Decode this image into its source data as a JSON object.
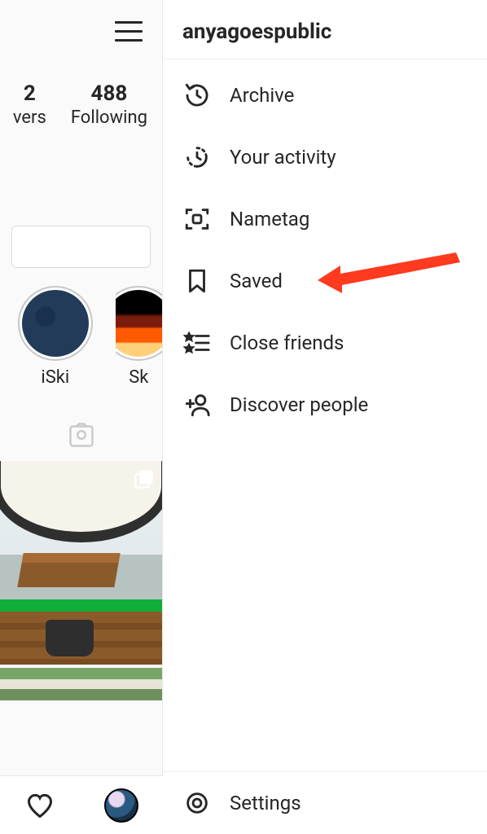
{
  "drawer": {
    "username": "anyagoespublic",
    "items": [
      {
        "label": "Archive",
        "icon": "archive"
      },
      {
        "label": "Your activity",
        "icon": "activity"
      },
      {
        "label": "Nametag",
        "icon": "nametag"
      },
      {
        "label": "Saved",
        "icon": "bookmark"
      },
      {
        "label": "Close friends",
        "icon": "closefriends"
      },
      {
        "label": "Discover people",
        "icon": "discover"
      }
    ],
    "footer": {
      "label": "Settings",
      "icon": "settings"
    }
  },
  "profile": {
    "stats": [
      {
        "value": "2",
        "label": "vers"
      },
      {
        "value": "488",
        "label": "Following"
      }
    ],
    "highlights": [
      {
        "label": "iSki"
      },
      {
        "label": "Sk"
      }
    ]
  },
  "annotation": {
    "arrow_color": "#ff3a1e"
  }
}
